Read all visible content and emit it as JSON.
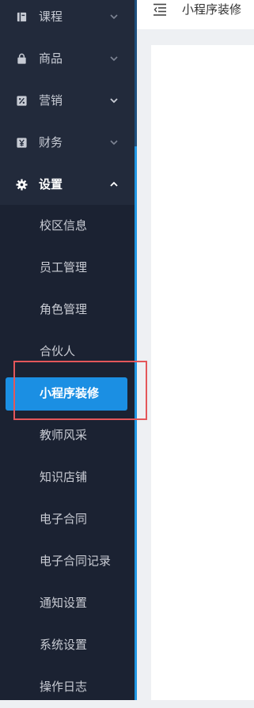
{
  "sidebar": {
    "items": [
      {
        "label": "课程",
        "icon": "book-icon"
      },
      {
        "label": "商品",
        "icon": "bag-icon"
      },
      {
        "label": "营销",
        "icon": "percent-icon"
      },
      {
        "label": "财务",
        "icon": "yen-icon"
      },
      {
        "label": "设置",
        "icon": "gear-icon"
      }
    ],
    "submenu": [
      "校区信息",
      "员工管理",
      "角色管理",
      "合伙人",
      "小程序装修",
      "教师风采",
      "知识店铺",
      "电子合同",
      "电子合同记录",
      "通知设置",
      "系统设置",
      "操作日志"
    ],
    "selected_submenu": "小程序装修"
  },
  "header": {
    "title": "小程序装修"
  },
  "colors": {
    "sidebar_bg": "#222a3b",
    "submenu_bg": "#1b2232",
    "accent": "#1b8fe3",
    "highlight_border": "#e4575a"
  }
}
